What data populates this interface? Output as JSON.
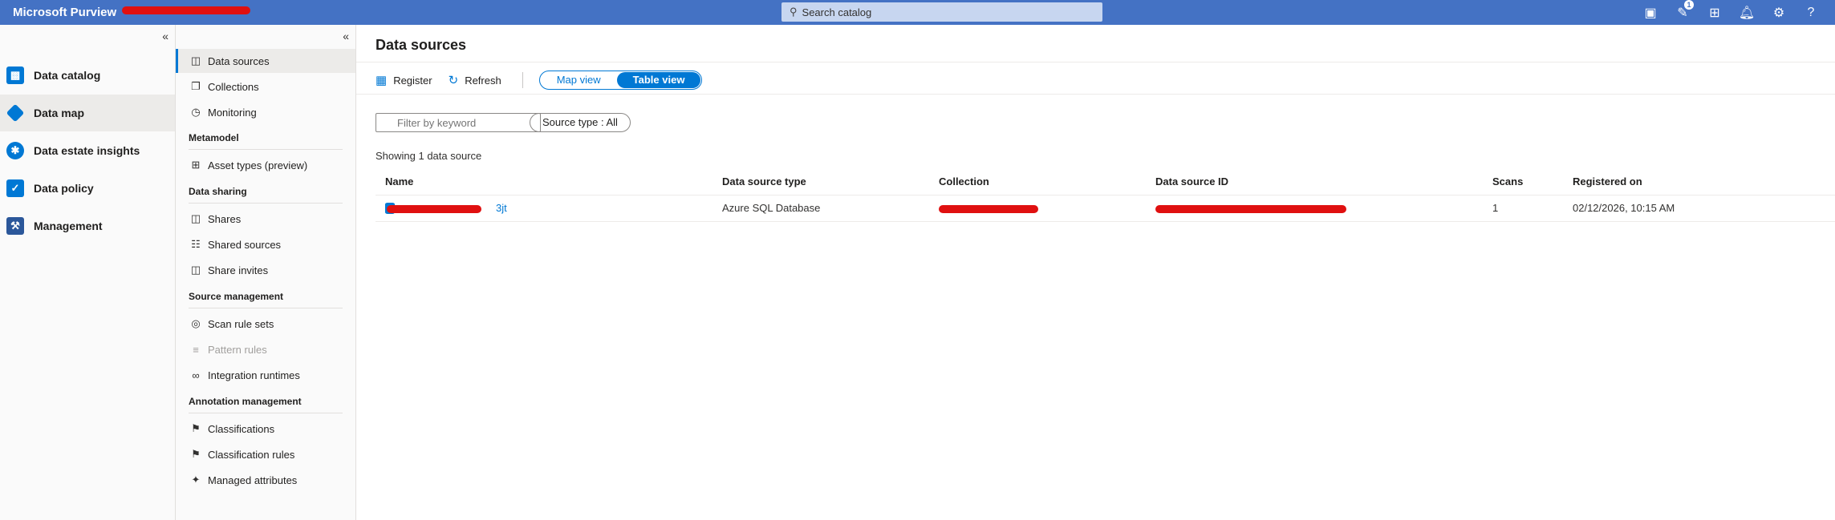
{
  "topbar": {
    "brand": "Microsoft Purview",
    "search_placeholder": "Search catalog",
    "notification_count": "1"
  },
  "rail": {
    "items": [
      {
        "label": "Data catalog",
        "color": "#0078d4"
      },
      {
        "label": "Data map",
        "color": "#0078d4"
      },
      {
        "label": "Data estate insights",
        "color": "#0078d4"
      },
      {
        "label": "Data policy",
        "color": "#0078d4"
      },
      {
        "label": "Management",
        "color": "#0078d4"
      }
    ]
  },
  "subnav": {
    "items": [
      {
        "label": "Data sources"
      },
      {
        "label": "Collections"
      },
      {
        "label": "Monitoring"
      }
    ],
    "sections": [
      {
        "heading": "Metamodel",
        "items": [
          {
            "label": "Asset types (preview)"
          }
        ]
      },
      {
        "heading": "Data sharing",
        "items": [
          {
            "label": "Shares"
          },
          {
            "label": "Shared sources"
          },
          {
            "label": "Share invites"
          }
        ]
      },
      {
        "heading": "Source management",
        "items": [
          {
            "label": "Scan rule sets"
          },
          {
            "label": "Pattern rules"
          },
          {
            "label": "Integration runtimes"
          }
        ]
      },
      {
        "heading": "Annotation management",
        "items": [
          {
            "label": "Classifications"
          },
          {
            "label": "Classification rules"
          },
          {
            "label": "Managed attributes"
          }
        ]
      }
    ]
  },
  "main": {
    "title": "Data sources",
    "toolbar": {
      "register": "Register",
      "refresh": "Refresh",
      "map_view": "Map view",
      "table_view": "Table view"
    },
    "filter_placeholder": "Filter by keyword",
    "source_type": "Source type : All",
    "showing": "Showing 1 data source",
    "table": {
      "headers": [
        "Name",
        "Data source type",
        "Collection",
        "Data source ID",
        "Scans",
        "Registered on"
      ],
      "rows": [
        {
          "name_suffix": "3jt",
          "type": "Azure SQL Database",
          "scans": "1",
          "registered": "02/12/2026, 10:15 AM"
        }
      ]
    }
  },
  "colors": {
    "accent": "#0078d4",
    "topbar": "#4472c4",
    "redaction": "#e01010"
  }
}
